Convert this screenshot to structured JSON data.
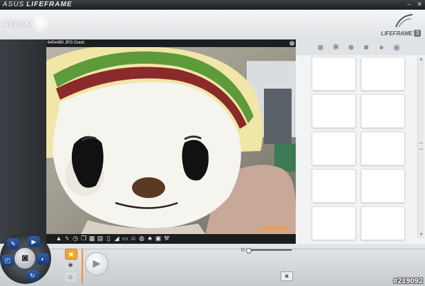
{
  "title_bar": {
    "asus": "ASUS",
    "app_name": "LIFEFRAME",
    "minimize_glyph": "–",
    "close_glyph": "✕"
  },
  "header": {
    "mode_label": "WEBCAM",
    "logo_text": "LIFEFRAME",
    "logo_version": "3"
  },
  "preview": {
    "info": "640x480 JPG Good",
    "close_glyph": "×",
    "date_stamp": "04/28/2008",
    "subject": "plush toy doll wearing a striped hat"
  },
  "toolbar": [
    {
      "name": "scene-icon",
      "glyph": "▲"
    },
    {
      "name": "flash-icon",
      "glyph": "ϟ"
    },
    {
      "name": "timer-icon",
      "glyph": "◷"
    },
    {
      "name": "burst-icon",
      "glyph": "❐"
    },
    {
      "name": "ruler-icon",
      "glyph": "▦"
    },
    {
      "name": "document-icon",
      "glyph": "▤"
    },
    {
      "name": "page-icon",
      "glyph": "▯"
    },
    {
      "name": "contrast-icon",
      "glyph": "◢"
    },
    {
      "name": "frame-icon",
      "glyph": "▭"
    },
    {
      "name": "face-icon",
      "glyph": "☺"
    },
    {
      "name": "mask-icon",
      "glyph": "◍"
    },
    {
      "name": "color-icon",
      "glyph": "♣"
    },
    {
      "name": "picture-icon",
      "glyph": "▣"
    },
    {
      "name": "wrench-icon",
      "glyph": "⚒"
    }
  ],
  "right_panel": {
    "category_icons": [
      {
        "name": "camera-category-icon",
        "glyph": "◙"
      },
      {
        "name": "gear-category-icon",
        "glyph": "✱"
      },
      {
        "name": "face-category-icon",
        "glyph": "☻"
      },
      {
        "name": "video-category-icon",
        "glyph": "■"
      },
      {
        "name": "microphone-category-icon",
        "glyph": "●"
      },
      {
        "name": "eye-category-icon",
        "glyph": "◉"
      }
    ],
    "thumbnail_count": 10
  },
  "bottom": {
    "mode_buttons": [
      {
        "name": "photo-mode-icon",
        "glyph": "◙"
      },
      {
        "name": "effect-mode-icon",
        "glyph": "✱"
      },
      {
        "name": "face-mode-icon",
        "glyph": "☺"
      }
    ],
    "play_glyph": "▶",
    "zoom_glyph": "⊙",
    "snapshot_glyph": "◙"
  },
  "dial": {
    "center_glyph": "◙",
    "segments": [
      {
        "name": "dial-edit-icon",
        "glyph": "✎"
      },
      {
        "name": "dial-video-icon",
        "glyph": "▶"
      },
      {
        "name": "dial-settings-icon",
        "glyph": "◐"
      },
      {
        "name": "dial-share-icon",
        "glyph": "↻"
      },
      {
        "name": "dial-folder-icon",
        "glyph": "◰"
      }
    ]
  },
  "watermark": "#219092",
  "colors": {
    "accent": "#f1a72e",
    "date_stamp": "#ff9a1c",
    "dial_blue": "#2f5fa8"
  }
}
